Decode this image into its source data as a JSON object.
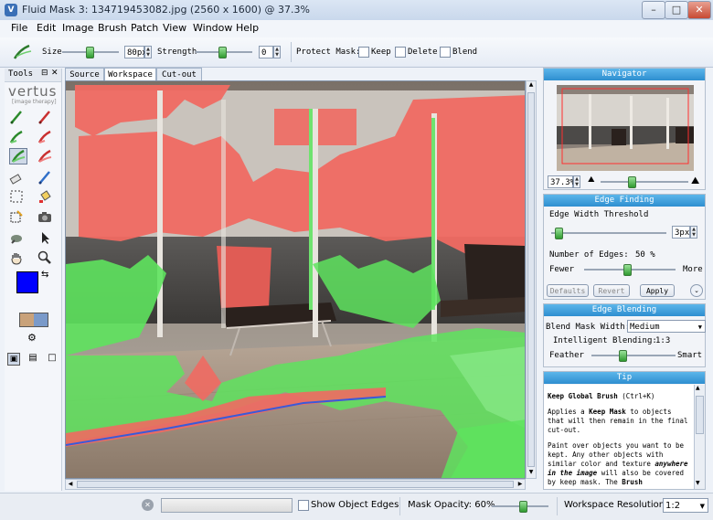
{
  "window": {
    "title": "Fluid Mask 3: 134719453082.jpg (2560 x 1600) @ 37.3%",
    "controls": [
      "–",
      "□",
      "✕"
    ]
  },
  "menu": [
    "File",
    "Edit",
    "Image",
    "Brush",
    "Patch",
    "View",
    "Window",
    "Help"
  ],
  "toolbar": {
    "size_label": "Size",
    "size_value": "80px",
    "strength_label": "Strength",
    "strength_value": "0",
    "protect_label": "Protect Mask:",
    "keep_label": "Keep",
    "delete_label": "Delete",
    "blend_label": "Blend"
  },
  "tools": {
    "header": "Tools",
    "header_icons": [
      "pin-icon",
      "close-icon"
    ],
    "logo_text": "vertus",
    "logo_sub": "[image therapy]"
  },
  "tabs": [
    "Source",
    "Workspace",
    "Cut-out"
  ],
  "active_tab": "Workspace",
  "navigator": {
    "title": "Navigator",
    "zoom": "37.3%"
  },
  "edge_finding": {
    "title": "Edge Finding",
    "width_label": "Edge Width Threshold",
    "width_value": "3px",
    "edges_label": "Number of Edges:",
    "edges_value": "50 %",
    "fewer": "Fewer",
    "more": "More",
    "btn_defaults": "Defaults",
    "btn_revert": "Revert",
    "btn_apply": "Apply"
  },
  "edge_blending": {
    "title": "Edge Blending",
    "mask_width_label": "Blend Mask Width:",
    "mask_width_value": "Medium",
    "intelligent_label": "Intelligent Blending:",
    "intelligent_value": "1:3",
    "feather": "Feather",
    "smart": "Smart"
  },
  "tip": {
    "title": "Tip",
    "heading": "Keep Global Brush",
    "shortcut": "(Ctrl+K)",
    "para1_a": "Applies a ",
    "para1_b": "Keep Mask",
    "para1_c": " to objects that will then remain in the final cut-out.",
    "para2_a": "Paint over objects you want to be kept. Any other objects with similar color and texture ",
    "para2_b": "anywhere in the image",
    "para2_c": " will also be covered by keep mask. The ",
    "para2_d": "Brush"
  },
  "status": {
    "show_edges": "Show Object Edges",
    "mask_opacity": "Mask Opacity: 60%",
    "workspace_resolution_label": "Workspace Resolution:",
    "workspace_resolution_value": "1:2"
  },
  "colors": {
    "panel_header": "#2e8ed0",
    "keep_mask": "#5ee35e",
    "delete_mask": "#f06060",
    "foreground": "#0000ff"
  }
}
